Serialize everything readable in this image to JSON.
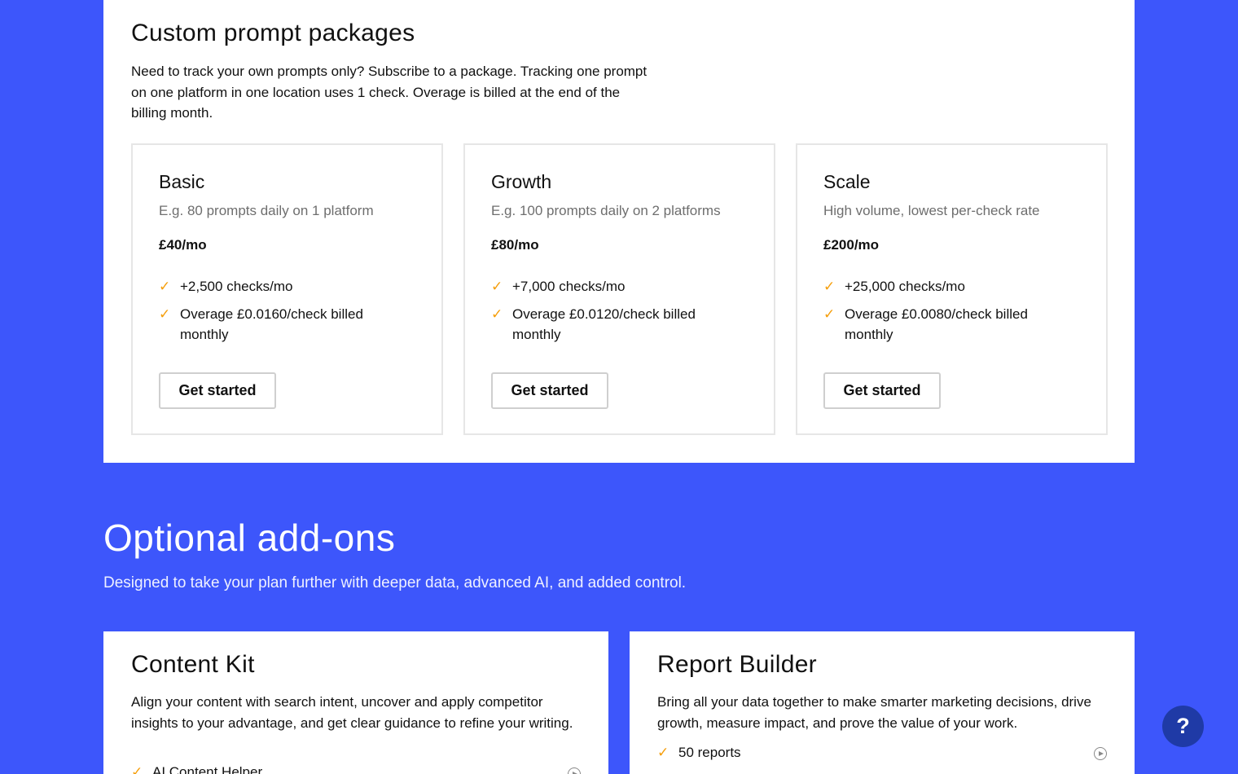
{
  "packages": {
    "title": "Custom prompt packages",
    "description": "Need to track your own prompts only? Subscribe to a package. Tracking one prompt on one platform in one location uses 1 check. Overage is billed at the end of the billing month.",
    "plans": [
      {
        "name": "Basic",
        "subtitle": "E.g. 80 prompts daily on 1 platform",
        "price": "£40/mo",
        "features": [
          "+2,500 checks/mo",
          "Overage £0.0160/check billed monthly"
        ],
        "cta": "Get started"
      },
      {
        "name": "Growth",
        "subtitle": "E.g. 100 prompts daily on 2 platforms",
        "price": "£80/mo",
        "features": [
          "+7,000 checks/mo",
          "Overage £0.0120/check billed monthly"
        ],
        "cta": "Get started"
      },
      {
        "name": "Scale",
        "subtitle": "High volume, lowest per-check rate",
        "price": "£200/mo",
        "features": [
          "+25,000 checks/mo",
          "Overage £0.0080/check billed monthly"
        ],
        "cta": "Get started"
      }
    ]
  },
  "addons": {
    "title": "Optional add-ons",
    "description": "Designed to take your plan further with deeper data, advanced AI, and added control.",
    "cards": [
      {
        "name": "Content Kit",
        "description": "Align your content with search intent, uncover and apply competitor insights to your advantage, and get clear guidance to refine your writing.",
        "feature": "AI Content Helper"
      },
      {
        "name": "Report Builder",
        "description": "Bring all your data together to make smarter marketing decisions, drive growth, measure impact, and prove the value of your work.",
        "feature": "50 reports"
      }
    ]
  },
  "help": {
    "label": "?"
  },
  "icons": {
    "check": "check-icon",
    "play": "play-circle-icon",
    "help": "question-icon"
  },
  "colors": {
    "background": "#3d56fb",
    "accent_check": "#f59e0b",
    "help_button": "#1f3aa6"
  }
}
